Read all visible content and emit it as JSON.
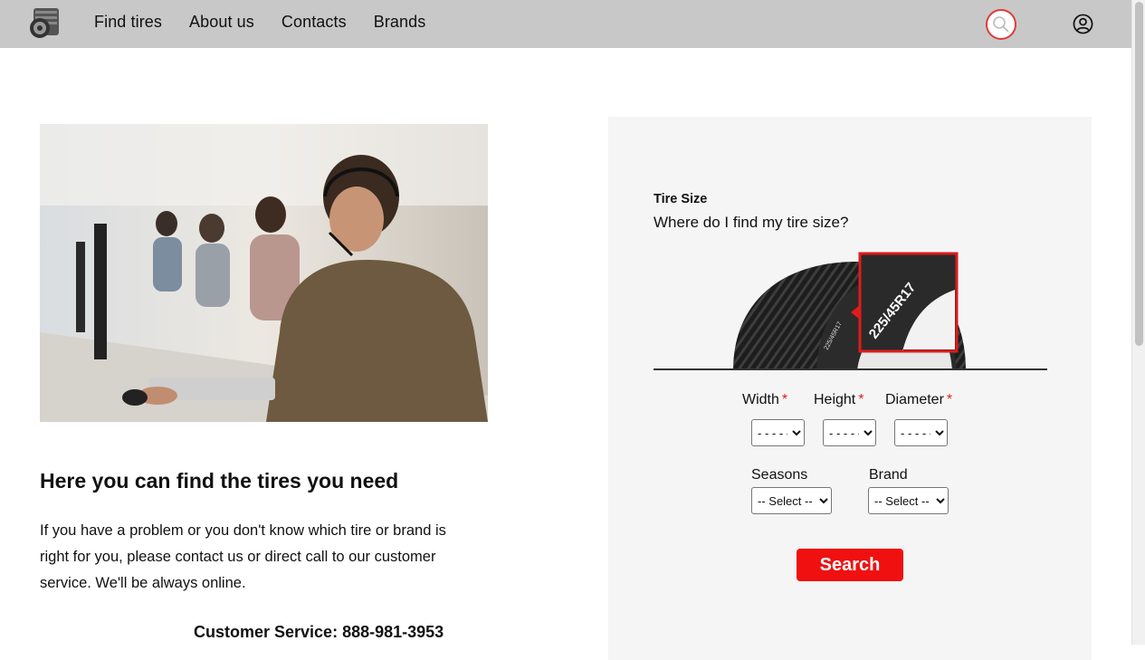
{
  "nav": {
    "items": [
      "Find tires",
      "About us",
      "Contacts",
      "Brands"
    ]
  },
  "icons": {
    "logo": "tire-logo-icon",
    "search": "search-icon",
    "account": "user-circle-icon"
  },
  "colors": {
    "header_bg": "#c8c8c8",
    "accent_red": "#f01010",
    "panel_bg": "#f5f5f5"
  },
  "info": {
    "headline": "Here you can find the tires you need",
    "description": "If you have a problem or you don't know which tire or brand is right for you, please contact us or direct call to our customer service. We'll be always online.",
    "phone": "Customer Service: 888-981-3953"
  },
  "finder": {
    "title": "Tire Size",
    "subtitle": "Where do I find my tire size?",
    "tire_size_example": "225/45R17",
    "width_label": "Width",
    "height_label": "Height",
    "diameter_label": "Diameter",
    "required_mark": "*",
    "width_value": "- - - - -",
    "height_value": "- - - - -",
    "diameter_value": "- - - - -",
    "seasons_label": "Seasons",
    "brand_label": "Brand",
    "seasons_value": "-- Select --",
    "brand_value": "-- Select --",
    "search_label": "Search"
  }
}
